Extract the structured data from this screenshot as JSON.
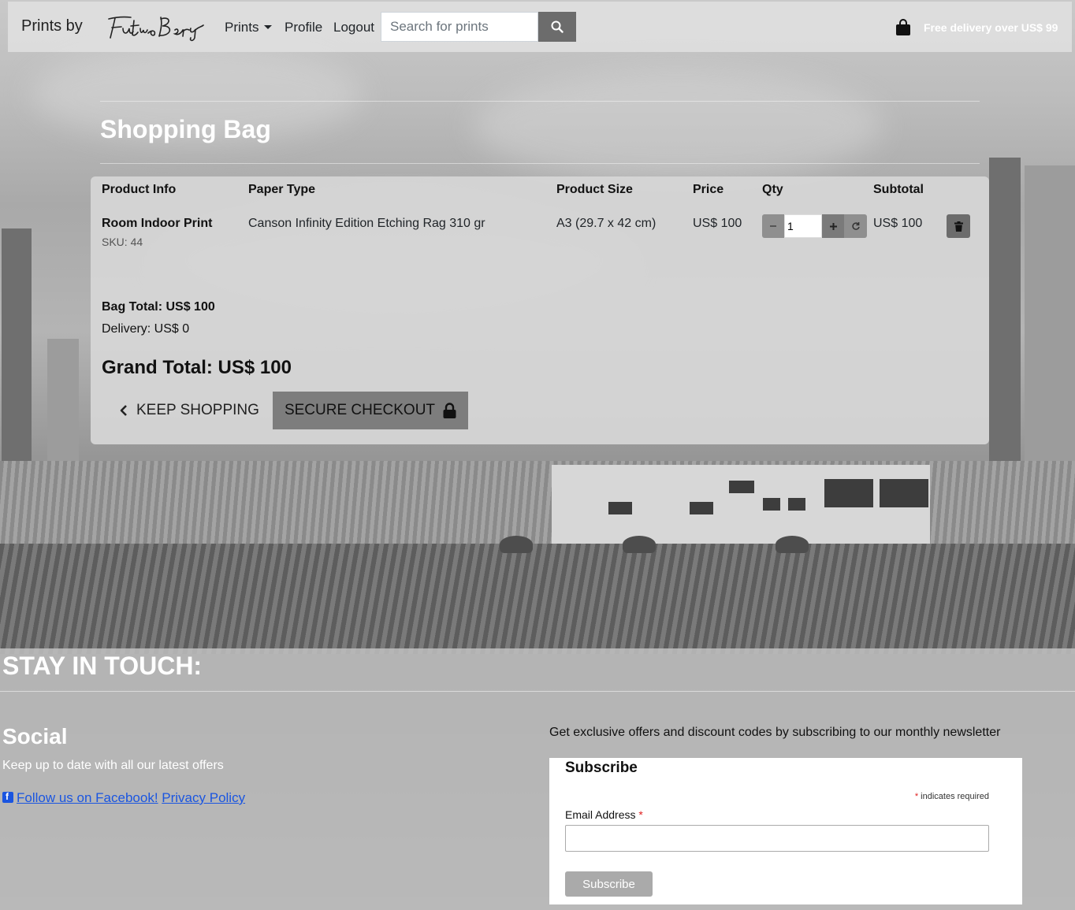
{
  "navbar": {
    "brand_text": "Prints by",
    "logo_text": "Futuro Berg",
    "prints_label": "Prints",
    "profile_label": "Profile",
    "logout_label": "Logout",
    "search_placeholder": "Search for prints",
    "free_delivery": "Free delivery over US$ 99"
  },
  "bag": {
    "title": "Shopping Bag",
    "headers": {
      "product_info": "Product Info",
      "paper_type": "Paper Type",
      "product_size": "Product Size",
      "price": "Price",
      "qty": "Qty",
      "subtotal": "Subtotal"
    },
    "items": [
      {
        "name": "Room Indoor Print",
        "sku": "SKU: 44",
        "paper_type": "Canson Infinity Edition Etching Rag 310 gr",
        "size": "A3 (29.7 x 42 cm)",
        "price": "US$ 100",
        "qty": "1",
        "subtotal": "US$ 100"
      }
    ],
    "bag_total": "Bag Total: US$ 100",
    "delivery": "Delivery: US$ 0",
    "grand_total": "Grand Total: US$ 100",
    "keep_shopping_label": "KEEP SHOPPING",
    "secure_checkout_label": "SECURE CHECKOUT"
  },
  "footer": {
    "title": "STAY IN TOUCH:",
    "social_title": "Social",
    "social_text": "Keep up to date with all our latest offers",
    "facebook_link": "Follow us on Facebook!",
    "privacy_link": "Privacy Policy",
    "newsletter_text": "Get exclusive offers and discount codes by subscribing to our monthly newsletter",
    "subscribe_title": "Subscribe",
    "required_note": "indicates required",
    "email_label": "Email Address",
    "subscribe_button": "Subscribe"
  },
  "icons": {
    "search": "search-icon",
    "bag": "shopping-bag-icon",
    "minus": "minus-icon",
    "plus": "plus-icon",
    "refresh": "refresh-icon",
    "trash": "trash-icon",
    "chevron": "chevron-left-icon",
    "lock": "lock-icon",
    "facebook": "facebook-icon"
  },
  "colors": {
    "link": "#1a55e0",
    "checkout_button": "#7d7d7d",
    "required_asterisk": "#e02020"
  }
}
